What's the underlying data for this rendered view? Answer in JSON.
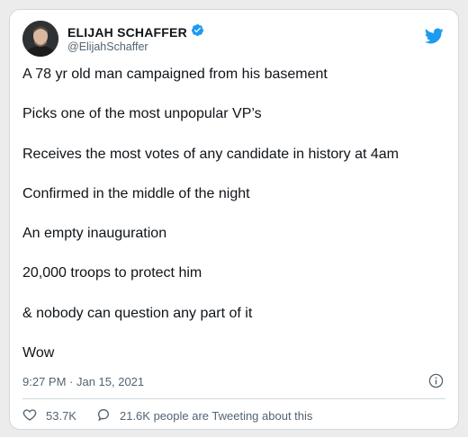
{
  "author": {
    "display_name": "ELIJAH SCHAFFER",
    "handle": "@ElijahSchaffer"
  },
  "tweet": {
    "lines": [
      "A 78 yr old man campaigned from his basement",
      "Picks one of the most unpopular VP’s",
      "Receives the most votes of any candidate in history at 4am",
      "Confirmed in the middle of the night",
      "An empty inauguration",
      "20,000 troops to protect him",
      "& nobody can question any part of it",
      "Wow"
    ],
    "timestamp": "9:27 PM · Jan 15, 2021"
  },
  "footer": {
    "likes": "53.7K",
    "tweeting_about": "21.6K people are Tweeting about this"
  },
  "icons": {
    "verified": "verified-badge-icon",
    "logo": "twitter-bird-icon",
    "info": "info-icon",
    "like": "heart-icon",
    "reply": "speech-bubble-icon"
  },
  "colors": {
    "brand": "#1d9bf0",
    "text": "#0f1419",
    "muted": "#536471"
  }
}
